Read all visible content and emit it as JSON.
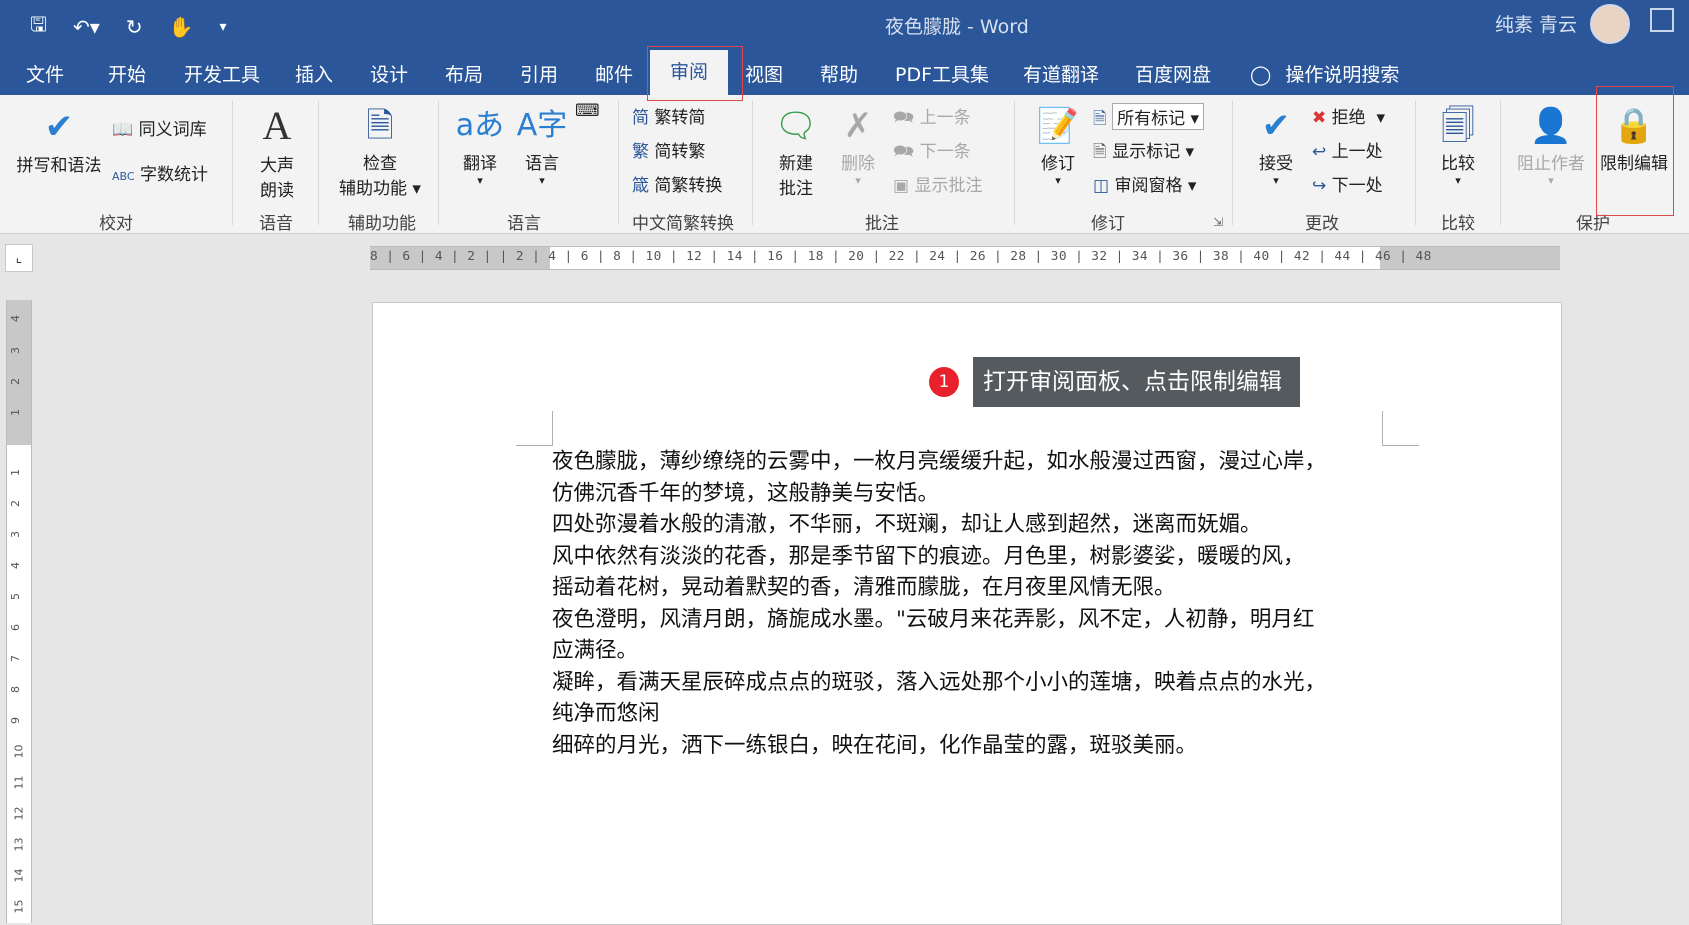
{
  "title_bar": {
    "document_title": "夜色朦胧  -  Word",
    "user_name": "纯素 青云",
    "qat_icons": [
      "save-icon",
      "undo-icon",
      "redo-icon",
      "touch-mode-icon",
      "customize-qat-icon"
    ]
  },
  "tabs": [
    "文件",
    "开始",
    "开发工具",
    "插入",
    "设计",
    "布局",
    "引用",
    "邮件",
    "审阅",
    "视图",
    "帮助",
    "PDF工具集",
    "有道翻译",
    "百度网盘",
    "操作说明搜索"
  ],
  "active_tab": "审阅",
  "ribbon": {
    "proofing": {
      "label": "校对",
      "spelling": "拼写和语法",
      "thesaurus": "同义词库",
      "word_count": "字数统计"
    },
    "speech": {
      "label": "语音",
      "read_aloud_1": "大声",
      "read_aloud_2": "朗读"
    },
    "accessibility": {
      "label": "辅助功能",
      "check_1": "检查",
      "check_2": "辅助功能"
    },
    "language": {
      "label": "语言",
      "translate": "翻译",
      "language": "语言"
    },
    "chinese_conversion": {
      "label": "中文简繁转换",
      "to_simplified": "繁转简",
      "to_traditional": "简转繁",
      "convert": "简繁转换"
    },
    "comments": {
      "label": "批注",
      "new_1": "新建",
      "new_2": "批注",
      "delete": "删除",
      "previous": "上一条",
      "next": "下一条",
      "show": "显示批注"
    },
    "tracking": {
      "label": "修订",
      "track": "修订",
      "markup_select": "所有标记",
      "show_markup": "显示标记",
      "review_pane": "审阅窗格"
    },
    "changes": {
      "label": "更改",
      "accept": "接受",
      "reject": "拒绝",
      "previous": "上一处",
      "next": "下一处"
    },
    "compare": {
      "label": "比较",
      "compare": "比较"
    },
    "protect": {
      "label": "保护",
      "block_authors": "阻止作者",
      "restrict_editing": "限制编辑"
    }
  },
  "ruler": {
    "horizontal": "8 |  6 |  4 |  2 |    | 2 |  4 |  6 |  8 | 10 | 12 | 14 | 16 | 18 | 20 | 22 | 24 | 26 | 28 | 30 | 32 | 34 | 36 | 38 | 40 | 42 | 44 | 46 | 48",
    "vertical_top": [
      "4",
      "3",
      "2",
      "1"
    ],
    "vertical_body": [
      "1",
      "2",
      "3",
      "4",
      "5",
      "6",
      "7",
      "8",
      "9",
      "10",
      "11",
      "12",
      "13",
      "14",
      "15"
    ]
  },
  "callout": {
    "number": "1",
    "text": "打开审阅面板、点击限制编辑"
  },
  "document": {
    "lines": [
      "夜色朦胧，薄纱缭绕的云雾中，一枚月亮缓缓升起，如水般漫过西窗，漫过心岸，",
      "仿佛沉香千年的梦境，这般静美与安恬。",
      "四处弥漫着水般的清澈，不华丽，不斑斓，却让人感到超然，迷离而妩媚。",
      "风中依然有淡淡的花香，那是季节留下的痕迹。月色里，树影婆娑，暖暖的风，",
      "摇动着花树，晃动着默契的香，清雅而朦胧，在月夜里风情无限。",
      "夜色澄明，风清月朗，旖旎成水墨。\"云破月来花弄影，风不定，人初静，明月红",
      "应满径。",
      "凝眸，看满天星辰碎成点点的斑驳，落入远处那个小小的莲塘，映着点点的水光，",
      "纯净而悠闲",
      "细碎的月光，洒下一练银白，映在花间，化作晶莹的露，斑驳美丽。"
    ]
  },
  "colors": {
    "title_blue": "#2b579a",
    "highlight_red": "#e0474c",
    "badge_red": "#e8222c",
    "callout_bg": "#555a5e"
  }
}
